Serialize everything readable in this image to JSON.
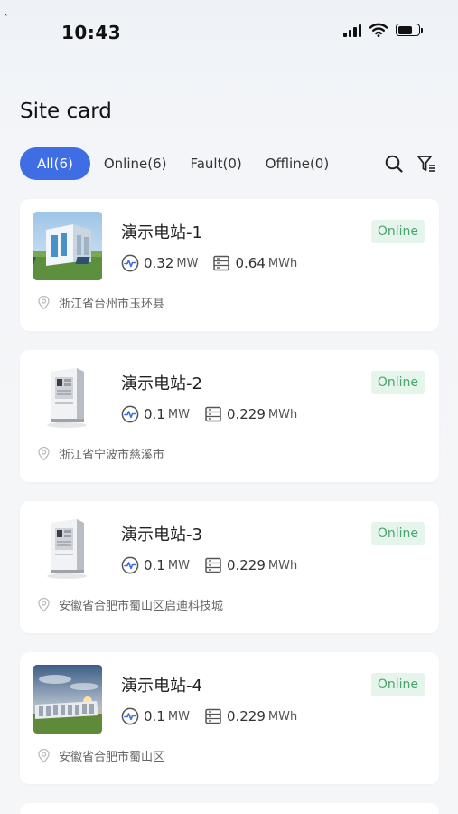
{
  "status_bar": {
    "corner_mark": "`",
    "time": "10:43"
  },
  "page": {
    "title": "Site card"
  },
  "tabs": [
    {
      "label": "All(6)",
      "active": true
    },
    {
      "label": "Online(6)",
      "active": false
    },
    {
      "label": "Fault(0)",
      "active": false
    },
    {
      "label": "Offline(0)",
      "active": false
    }
  ],
  "toolbar": {
    "search_icon": "search-icon",
    "filter_icon": "filter-icon"
  },
  "colors": {
    "accent": "#3f6ee4",
    "online_bg": "#e6f5ec",
    "online_text": "#4aa46b"
  },
  "sites": [
    {
      "name": "演示电站-1",
      "status": "Online",
      "power": "0.32",
      "power_unit": "MW",
      "energy": "0.64",
      "energy_unit": "MWh",
      "address": "浙江省台州市玉环县",
      "thumb": "container-photo"
    },
    {
      "name": "演示电站-2",
      "status": "Online",
      "power": "0.1",
      "power_unit": "MW",
      "energy": "0.229",
      "energy_unit": "MWh",
      "address": "浙江省宁波市慈溪市",
      "thumb": "cabinet"
    },
    {
      "name": "演示电站-3",
      "status": "Online",
      "power": "0.1",
      "power_unit": "MW",
      "energy": "0.229",
      "energy_unit": "MWh",
      "address": "安徽省合肥市蜀山区启迪科技城",
      "thumb": "cabinet"
    },
    {
      "name": "演示电站-4",
      "status": "Online",
      "power": "0.1",
      "power_unit": "MW",
      "energy": "0.229",
      "energy_unit": "MWh",
      "address": "安徽省合肥市蜀山区",
      "thumb": "sunset-photo"
    }
  ]
}
